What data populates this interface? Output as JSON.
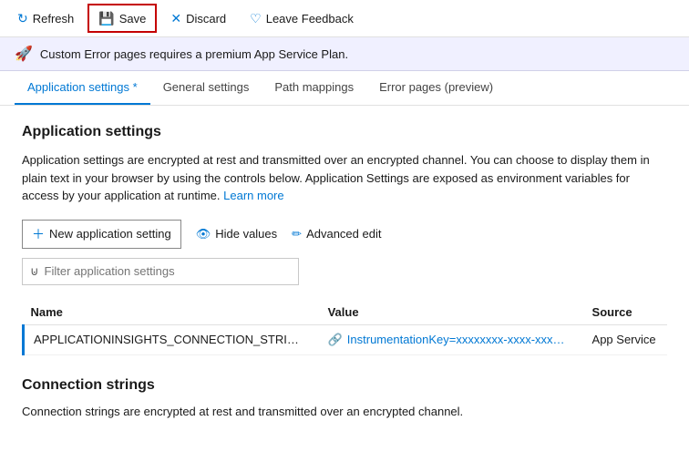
{
  "toolbar": {
    "refresh_label": "Refresh",
    "save_label": "Save",
    "discard_label": "Discard",
    "leave_feedback_label": "Leave Feedback"
  },
  "banner": {
    "text": "Custom Error pages requires a premium App Service Plan."
  },
  "tabs": [
    {
      "id": "application-settings",
      "label": "Application settings",
      "active": true,
      "asterisk": true
    },
    {
      "id": "general-settings",
      "label": "General settings",
      "active": false
    },
    {
      "id": "path-mappings",
      "label": "Path mappings",
      "active": false
    },
    {
      "id": "error-pages",
      "label": "Error pages (preview)",
      "active": false
    }
  ],
  "main": {
    "section_title": "Application settings",
    "description_part1": "Application settings are encrypted at rest and transmitted over an encrypted channel. You can choose to display them in plain text in your browser by using the controls below. Application Settings are exposed as environment variables for access by your application at runtime.",
    "learn_more_label": "Learn more",
    "actions": {
      "new_label": "New application setting",
      "hide_values_label": "Hide values",
      "advanced_edit_label": "Advanced edit"
    },
    "filter_placeholder": "Filter application settings",
    "table": {
      "columns": [
        "Name",
        "Value",
        "Source"
      ],
      "rows": [
        {
          "name": "APPLICATIONINSIGHTS_CONNECTION_STRI…",
          "value": "InstrumentationKey=xxxxxxxx-xxxx-xxx…",
          "source": "App Service"
        }
      ]
    }
  },
  "connection_strings": {
    "title": "Connection strings",
    "description": "Connection strings are encrypted at rest and transmitted over an encrypted channel."
  }
}
